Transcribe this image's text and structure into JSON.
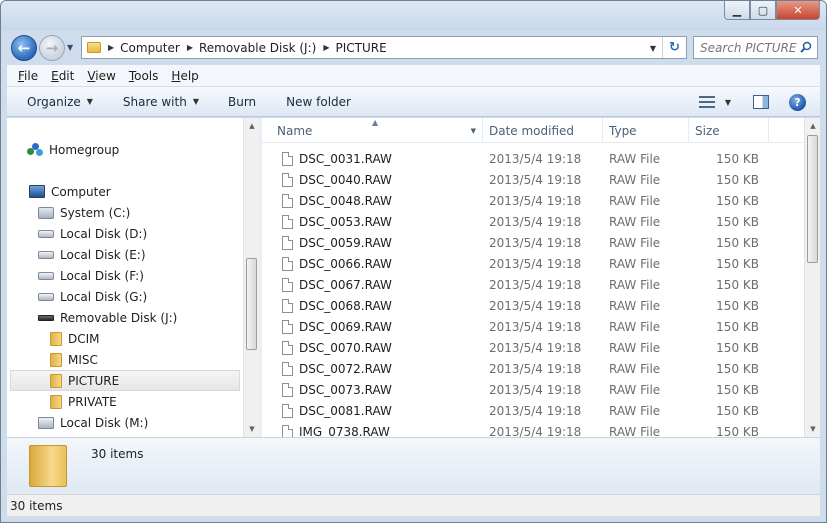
{
  "window": {
    "minimize_glyph": "▁",
    "maximize_glyph": "▢",
    "close_glyph": "✕"
  },
  "address": {
    "breadcrumbs": [
      "Computer",
      "Removable Disk (J:)",
      "PICTURE"
    ]
  },
  "search": {
    "placeholder": "Search PICTURE"
  },
  "menu": {
    "items": [
      "File",
      "Edit",
      "View",
      "Tools",
      "Help"
    ]
  },
  "toolbar": {
    "organize_label": "Organize",
    "share_label": "Share with",
    "burn_label": "Burn",
    "newfolder_label": "New folder",
    "help_glyph": "?"
  },
  "navigation": {
    "items": [
      {
        "label": "Homegroup",
        "icon": "homegroup-icon"
      },
      {
        "label": "Computer",
        "icon": "computer-icon"
      },
      {
        "label": "System (C:)",
        "icon": "system-drive-icon"
      },
      {
        "label": "Local Disk (D:)",
        "icon": "drive-icon"
      },
      {
        "label": "Local Disk (E:)",
        "icon": "drive-icon"
      },
      {
        "label": "Local Disk (F:)",
        "icon": "drive-icon"
      },
      {
        "label": "Local Disk (G:)",
        "icon": "drive-icon"
      },
      {
        "label": "Removable Disk (J:)",
        "icon": "removable-drive-icon"
      },
      {
        "label": "DCIM",
        "icon": "folder-icon"
      },
      {
        "label": "MISC",
        "icon": "folder-icon"
      },
      {
        "label": "PICTURE",
        "icon": "folder-icon",
        "selected": true
      },
      {
        "label": "PRIVATE",
        "icon": "folder-icon"
      },
      {
        "label": "Local Disk (M:)",
        "icon": "network-drive-icon"
      }
    ]
  },
  "file_list": {
    "columns": [
      "Name",
      "Date modified",
      "Type",
      "Size"
    ],
    "rows": [
      {
        "name": "DSC_0031.RAW",
        "date": "2013/5/4 19:18",
        "type": "RAW File",
        "size": "150 KB"
      },
      {
        "name": "DSC_0040.RAW",
        "date": "2013/5/4 19:18",
        "type": "RAW File",
        "size": "150 KB"
      },
      {
        "name": "DSC_0048.RAW",
        "date": "2013/5/4 19:18",
        "type": "RAW File",
        "size": "150 KB"
      },
      {
        "name": "DSC_0053.RAW",
        "date": "2013/5/4 19:18",
        "type": "RAW File",
        "size": "150 KB"
      },
      {
        "name": "DSC_0059.RAW",
        "date": "2013/5/4 19:18",
        "type": "RAW File",
        "size": "150 KB"
      },
      {
        "name": "DSC_0066.RAW",
        "date": "2013/5/4 19:18",
        "type": "RAW File",
        "size": "150 KB"
      },
      {
        "name": "DSC_0067.RAW",
        "date": "2013/5/4 19:18",
        "type": "RAW File",
        "size": "150 KB"
      },
      {
        "name": "DSC_0068.RAW",
        "date": "2013/5/4 19:18",
        "type": "RAW File",
        "size": "150 KB"
      },
      {
        "name": "DSC_0069.RAW",
        "date": "2013/5/4 19:18",
        "type": "RAW File",
        "size": "150 KB"
      },
      {
        "name": "DSC_0070.RAW",
        "date": "2013/5/4 19:18",
        "type": "RAW File",
        "size": "150 KB"
      },
      {
        "name": "DSC_0072.RAW",
        "date": "2013/5/4 19:18",
        "type": "RAW File",
        "size": "150 KB"
      },
      {
        "name": "DSC_0073.RAW",
        "date": "2013/5/4 19:18",
        "type": "RAW File",
        "size": "150 KB"
      },
      {
        "name": "DSC_0081.RAW",
        "date": "2013/5/4 19:18",
        "type": "RAW File",
        "size": "150 KB"
      },
      {
        "name": "IMG_0738.RAW",
        "date": "2013/5/4 19:18",
        "type": "RAW File",
        "size": "150 KB"
      }
    ]
  },
  "details": {
    "item_count": "30 items"
  },
  "status": {
    "text": "30 items"
  }
}
